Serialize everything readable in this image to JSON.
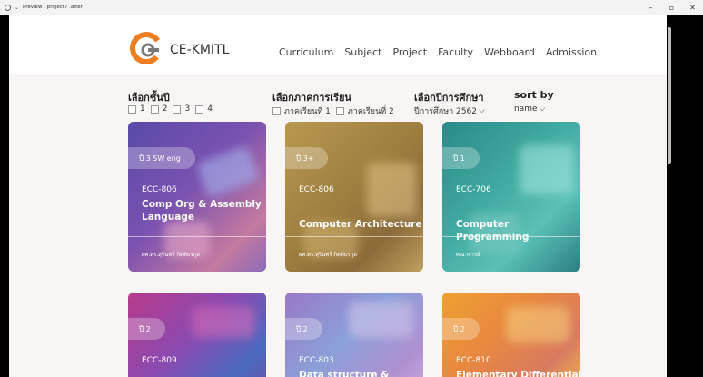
{
  "window": {
    "title": "Preview : project7 .after",
    "minimize": "–",
    "maximize": "▫",
    "close": "✕"
  },
  "nav": {
    "logo_text": "CE-KMITL",
    "menu": [
      "Curriculum",
      "Subject",
      "Project",
      "Faculty",
      "Webboard",
      "Admission"
    ]
  },
  "filters": {
    "year": {
      "label": "เลือกชั้นปี",
      "options": [
        "1",
        "2",
        "3",
        "4"
      ]
    },
    "semester": {
      "label": "เลือกภาคการเรียน",
      "options": [
        "ภาคเรียนที่ 1",
        "ภาคเรียนที่ 2"
      ]
    },
    "academic_year": {
      "label": "เลือกปีการศึกษา",
      "value": "ปีการศึกษา 2562"
    },
    "sort": {
      "label": "sort by",
      "value": "name"
    }
  },
  "cards": [
    {
      "badge": "ปี 3 SW eng",
      "code": "ECC-806",
      "name": "Comp Org & Assembly Language",
      "teacher": "ผศ.ดร.สุรินทร์ กิตติธรกุล"
    },
    {
      "badge": "ปี 3+",
      "code": "ECC-806",
      "name": "Computer Architecture",
      "teacher": "ผศ.ดร.สุรินทร์ กิตติธรกุล"
    },
    {
      "badge": "ปี 1",
      "code": "ECC-706",
      "name": "Computer Programming",
      "teacher": "คณาจารย์"
    },
    {
      "badge": "ปี 2",
      "code": "ECC-809",
      "name": "",
      "teacher": ""
    },
    {
      "badge": "ปี 2",
      "code": "ECC-803",
      "name": "Data structure &",
      "teacher": ""
    },
    {
      "badge": "ปี 2",
      "code": "ECC-810",
      "name": "Elementary Differential",
      "teacher": ""
    }
  ],
  "colors": {
    "logo_orange": "#ef7d22",
    "logo_gray": "#7a7a7a",
    "page_bg": "#f9f5f4"
  }
}
